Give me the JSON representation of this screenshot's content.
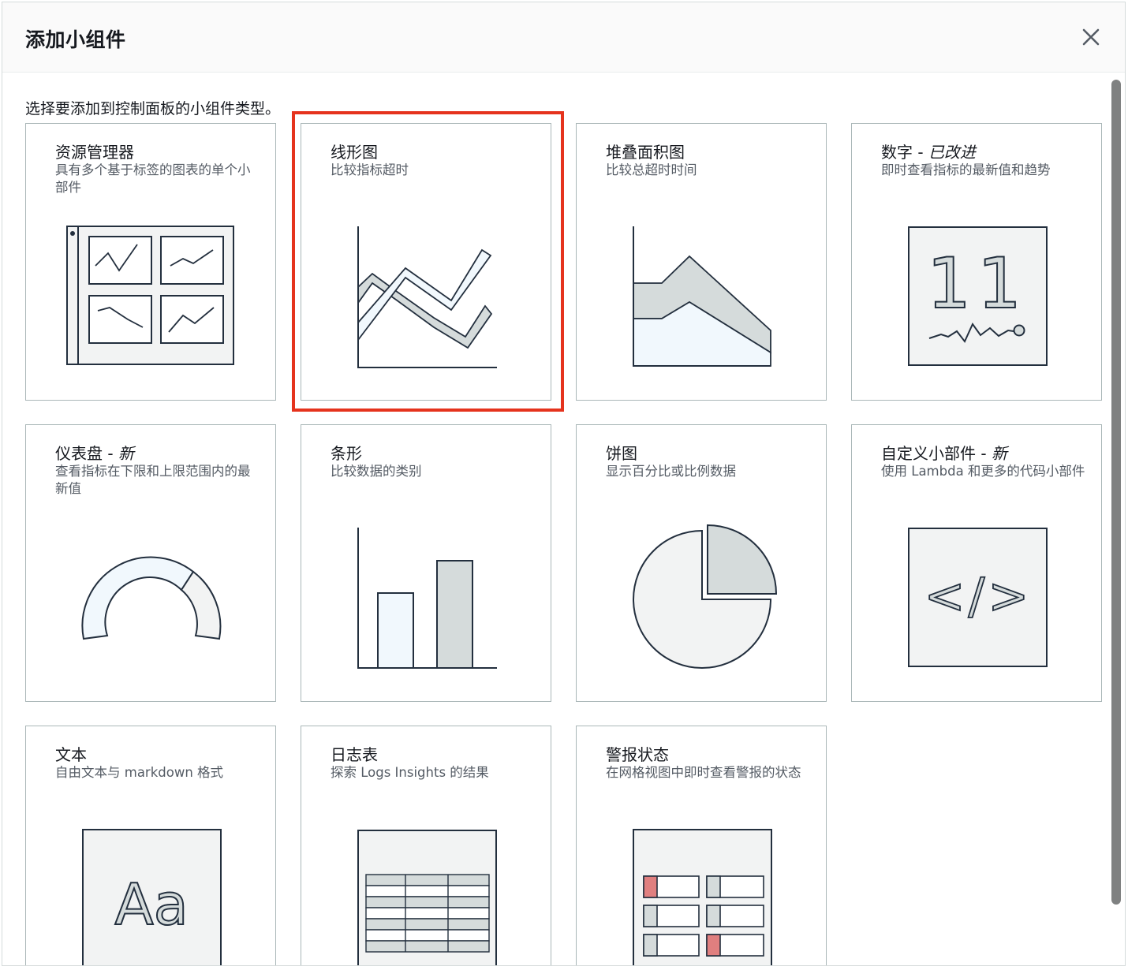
{
  "modal": {
    "title": "添加小组件",
    "intro": "选择要添加到控制面板的小组件类型。"
  },
  "widgets": [
    {
      "id": "explorer",
      "title": "资源管理器",
      "desc": "具有多个基于标签的图表的单个小部件",
      "icon": "explorer-grid-icon"
    },
    {
      "id": "line",
      "title": "线形图",
      "desc": "比较指标超时",
      "icon": "line-chart-icon",
      "selected": true
    },
    {
      "id": "stacked-area",
      "title": "堆叠面积图",
      "desc": "比较总超时时间",
      "icon": "stacked-area-icon"
    },
    {
      "id": "number",
      "title": "数字 - ",
      "title_tag": "已改进",
      "desc": "即时查看指标的最新值和趋势",
      "icon": "number-icon",
      "number_glyph": "11"
    },
    {
      "id": "gauge",
      "title": "仪表盘 - ",
      "title_tag": "新",
      "desc": "查看指标在下限和上限范围内的最新值",
      "icon": "gauge-icon"
    },
    {
      "id": "bar",
      "title": "条形",
      "desc": "比较数据的类别",
      "icon": "bar-chart-icon"
    },
    {
      "id": "pie",
      "title": "饼图",
      "desc": "显示百分比或比例数据",
      "icon": "pie-chart-icon"
    },
    {
      "id": "custom",
      "title": "自定义小部件 - ",
      "title_tag": "新",
      "desc": "使用 Lambda 和更多的代码小部件",
      "icon": "code-icon",
      "code_glyph": "</>"
    },
    {
      "id": "text",
      "title": "文本",
      "desc": "自由文本与 markdown 格式",
      "icon": "text-icon",
      "text_glyph": "Aa"
    },
    {
      "id": "logs",
      "title": "日志表",
      "desc": "探索 Logs Insights 的结果",
      "icon": "log-table-icon"
    },
    {
      "id": "alarm",
      "title": "警报状态",
      "desc": "在网格视图中即时查看警报的状态",
      "icon": "alarm-status-icon"
    }
  ],
  "colors": {
    "selection": "#e5331d",
    "illustration_fill": "#f2f3f3",
    "illustration_stroke": "#232f3e",
    "illustration_gray": "#d5dbdb",
    "illustration_light": "#f1f8fd",
    "alarm_red": "#e07f7f"
  }
}
